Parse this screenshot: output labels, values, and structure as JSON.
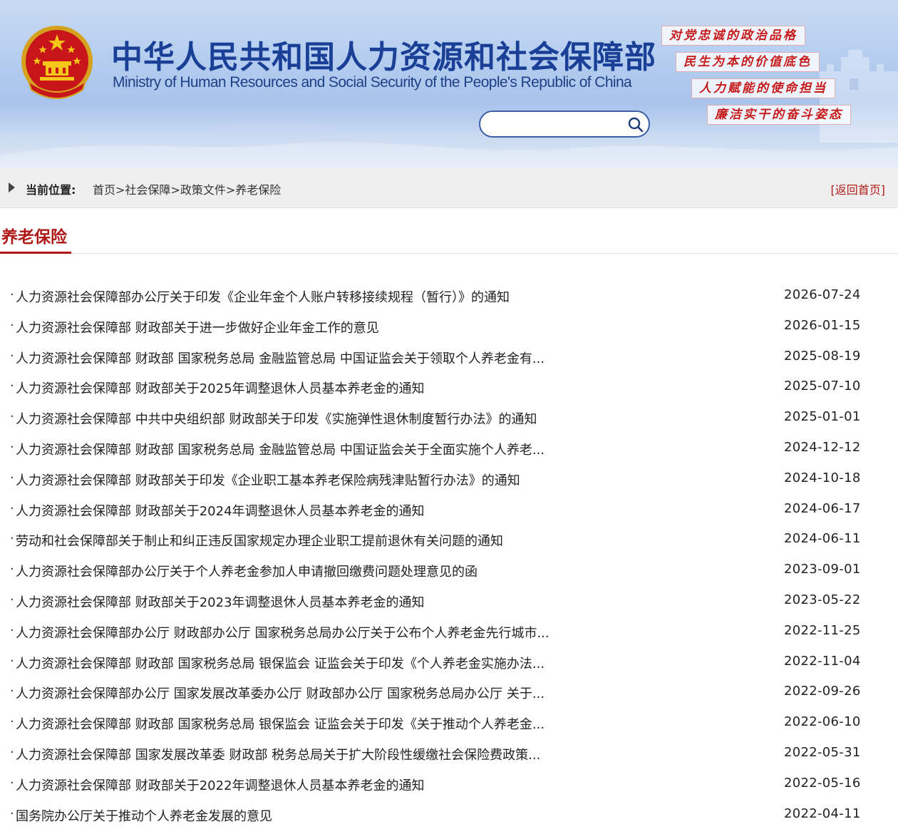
{
  "header": {
    "cn_title": "中华人民共和国人力资源和社会保障部",
    "en_title": "Ministry of Human Resources and Social Security of the People's Republic of China",
    "search": {
      "value": "",
      "placeholder": ""
    },
    "slogans": [
      "对党忠诚的政治品格",
      "民生为本的价值底色",
      "人力赋能的使命担当",
      "廉洁实干的奋斗姿态"
    ],
    "icons": {
      "emblem": "national-emblem-icon",
      "search": "search-icon"
    }
  },
  "breadcrumb": {
    "label": "当前位置:",
    "items": [
      "首页",
      "社会保障",
      "政策文件",
      "养老保险"
    ],
    "separator": ">",
    "home_link": "[返回首页]"
  },
  "section": {
    "title": "养老保险"
  },
  "items": [
    {
      "title": "人力资源社会保障部办公厅关于印发《企业年金个人账户转移接续规程（暂行）》的通知",
      "date": "2026-07-24"
    },
    {
      "title": "人力资源社会保障部 财政部关于进一步做好企业年金工作的意见",
      "date": "2026-01-15"
    },
    {
      "title": "人力资源社会保障部 财政部 国家税务总局 金融监管总局 中国证监会关于领取个人养老金有...",
      "date": "2025-08-19"
    },
    {
      "title": "人力资源社会保障部 财政部关于2025年调整退休人员基本养老金的通知",
      "date": "2025-07-10"
    },
    {
      "title": "人力资源社会保障部 中共中央组织部 财政部关于印发《实施弹性退休制度暂行办法》的通知",
      "date": "2025-01-01"
    },
    {
      "title": "人力资源社会保障部 财政部 国家税务总局 金融监管总局 中国证监会关于全面实施个人养老...",
      "date": "2024-12-12"
    },
    {
      "title": "人力资源社会保障部 财政部关于印发《企业职工基本养老保险病残津贴暂行办法》的通知",
      "date": "2024-10-18"
    },
    {
      "title": "人力资源社会保障部 财政部关于2024年调整退休人员基本养老金的通知",
      "date": "2024-06-17"
    },
    {
      "title": "劳动和社会保障部关于制止和纠正违反国家规定办理企业职工提前退休有关问题的通知",
      "date": "2024-06-11"
    },
    {
      "title": "人力资源社会保障部办公厅关于个人养老金参加人申请撤回缴费问题处理意见的函",
      "date": "2023-09-01"
    },
    {
      "title": "人力资源社会保障部 财政部关于2023年调整退休人员基本养老金的通知",
      "date": "2023-05-22"
    },
    {
      "title": "人力资源社会保障部办公厅 财政部办公厅 国家税务总局办公厅关于公布个人养老金先行城市...",
      "date": "2022-11-25"
    },
    {
      "title": "人力资源社会保障部 财政部 国家税务总局 银保监会 证监会关于印发《个人养老金实施办法...",
      "date": "2022-11-04"
    },
    {
      "title": "人力资源社会保障部办公厅 国家发展改革委办公厅 财政部办公厅 国家税务总局办公厅 关于...",
      "date": "2022-09-26"
    },
    {
      "title": "人力资源社会保障部 财政部 国家税务总局 银保监会 证监会关于印发《关于推动个人养老金...",
      "date": "2022-06-10"
    },
    {
      "title": "人力资源社会保障部 国家发展改革委 财政部 税务总局关于扩大阶段性缓缴社会保险费政策...",
      "date": "2022-05-31"
    },
    {
      "title": "人力资源社会保障部 财政部关于2022年调整退休人员基本养老金的通知",
      "date": "2022-05-16"
    },
    {
      "title": "国务院办公厅关于推动个人养老金发展的意见",
      "date": "2022-04-11"
    }
  ],
  "colors": {
    "brand_blue": "#1a3f96",
    "accent_red": "#b01818",
    "link_red": "#b0201e",
    "crumb_bg": "#efefef"
  }
}
